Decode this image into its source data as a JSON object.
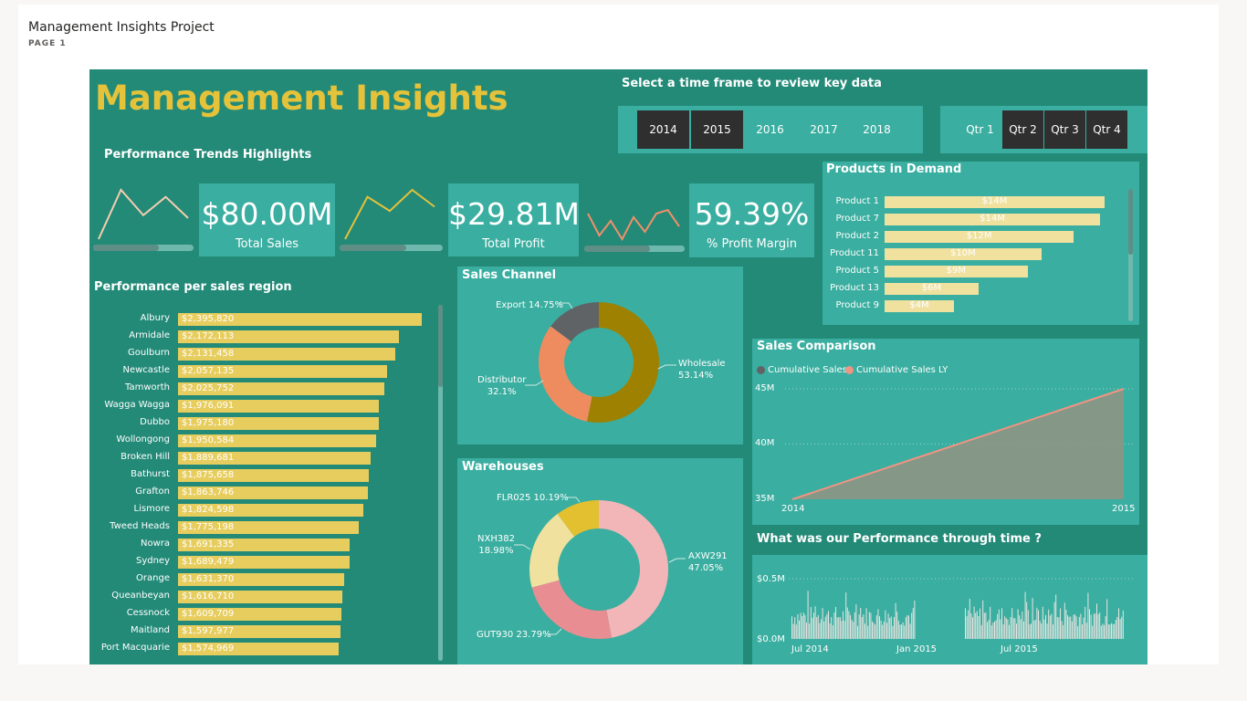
{
  "report": {
    "title": "Management Insights Project",
    "page_label": "PAGE 1"
  },
  "dashboard": {
    "title": "Management Insights",
    "time_caption": "Select a time frame to review key data",
    "years": [
      {
        "label": "2014",
        "selected": true
      },
      {
        "label": "2015",
        "selected": true
      },
      {
        "label": "2016",
        "selected": false
      },
      {
        "label": "2017",
        "selected": false
      },
      {
        "label": "2018",
        "selected": false
      }
    ],
    "quarters": [
      {
        "label": "Qtr 1",
        "selected": false
      },
      {
        "label": "Qtr 2",
        "selected": true
      },
      {
        "label": "Qtr 3",
        "selected": true
      },
      {
        "label": "Qtr 4",
        "selected": true
      }
    ],
    "trends_title": "Performance Trends Highlights",
    "kpis": [
      {
        "value": "$80.00M",
        "label": "Total Sales",
        "spark_color": "#f5cdb0",
        "spark": [
          5,
          40,
          22,
          35,
          20
        ],
        "progress": 0.65
      },
      {
        "value": "$29.81M",
        "label": "Total Profit",
        "spark_color": "#e4c23a",
        "spark": [
          5,
          35,
          25,
          40,
          28
        ],
        "progress": 0.65
      },
      {
        "value": "59.39%",
        "label": "% Profit Margin",
        "spark_color": "#f0906a",
        "spark": [
          22,
          10,
          18,
          8,
          20,
          12,
          22,
          24,
          15
        ],
        "progress": 0.65
      }
    ]
  },
  "regions": {
    "title": "Performance per sales region",
    "rows": [
      {
        "name": "Albury",
        "label": "$2,395,820",
        "value": 2395820
      },
      {
        "name": "Armidale",
        "label": "$2,172,113",
        "value": 2172113
      },
      {
        "name": "Goulburn",
        "label": "$2,131,458",
        "value": 2131458
      },
      {
        "name": "Newcastle",
        "label": "$2,057,135",
        "value": 2057135
      },
      {
        "name": "Tamworth",
        "label": "$2,025,752",
        "value": 2025752
      },
      {
        "name": "Wagga Wagga",
        "label": "$1,976,091",
        "value": 1976091
      },
      {
        "name": "Dubbo",
        "label": "$1,975,180",
        "value": 1975180
      },
      {
        "name": "Wollongong",
        "label": "$1,950,584",
        "value": 1950584
      },
      {
        "name": "Broken Hill",
        "label": "$1,889,681",
        "value": 1889681
      },
      {
        "name": "Bathurst",
        "label": "$1,875,658",
        "value": 1875658
      },
      {
        "name": "Grafton",
        "label": "$1,863,746",
        "value": 1863746
      },
      {
        "name": "Lismore",
        "label": "$1,824,598",
        "value": 1824598
      },
      {
        "name": "Tweed Heads",
        "label": "$1,775,198",
        "value": 1775198
      },
      {
        "name": "Nowra",
        "label": "$1,691,335",
        "value": 1691335
      },
      {
        "name": "Sydney",
        "label": "$1,689,479",
        "value": 1689479
      },
      {
        "name": "Orange",
        "label": "$1,631,370",
        "value": 1631370
      },
      {
        "name": "Queanbeyan",
        "label": "$1,616,710",
        "value": 1616710
      },
      {
        "name": "Cessnock",
        "label": "$1,609,709",
        "value": 1609709
      },
      {
        "name": "Maitland",
        "label": "$1,597,977",
        "value": 1597977
      },
      {
        "name": "Port Macquarie",
        "label": "$1,574,969",
        "value": 1574969
      }
    ]
  },
  "sales_channel": {
    "title": "Sales Channel",
    "slices": [
      {
        "name": "Wholesale",
        "label": "Wholesale",
        "pct_label": "53.14%",
        "value": 53.14,
        "color": "#9e8100"
      },
      {
        "name": "Distributor",
        "label": "Distributor",
        "pct_label": "32.1%",
        "value": 32.1,
        "color": "#ef8c5f"
      },
      {
        "name": "Export",
        "label": "Export 14.75%",
        "pct_label": "",
        "value": 14.75,
        "color": "#5f6366"
      }
    ]
  },
  "warehouses": {
    "title": "Warehouses",
    "slices": [
      {
        "name": "AXW291",
        "label": "AXW291",
        "pct_label": "47.05%",
        "value": 47.05,
        "color": "#f2b6b8"
      },
      {
        "name": "GUT930",
        "label": "GUT930 23.79%",
        "pct_label": "",
        "value": 23.79,
        "color": "#e88d92"
      },
      {
        "name": "NXH382",
        "label": "NXH382",
        "pct_label": "18.98%",
        "value": 18.98,
        "color": "#f0e19f"
      },
      {
        "name": "FLR025",
        "label": "FLR025 10.19%",
        "pct_label": "",
        "value": 10.19,
        "color": "#e2c02f"
      }
    ]
  },
  "products": {
    "title": "Products in Demand",
    "rows": [
      {
        "name": "Product 1",
        "label": "$14M",
        "value": 14.3
      },
      {
        "name": "Product 7",
        "label": "$14M",
        "value": 14.0
      },
      {
        "name": "Product 2",
        "label": "$12M",
        "value": 12.3
      },
      {
        "name": "Product 11",
        "label": "$10M",
        "value": 10.2
      },
      {
        "name": "Product 5",
        "label": "$9M",
        "value": 9.3
      },
      {
        "name": "Product 13",
        "label": "$6M",
        "value": 6.1
      },
      {
        "name": "Product 9",
        "label": "$4M",
        "value": 4.5
      }
    ]
  },
  "sales_comparison": {
    "title": "Sales Comparison",
    "legend": [
      {
        "label": "Cumulative Sales",
        "color": "#5f6366"
      },
      {
        "label": "Cumulative Sales LY",
        "color": "#f09483"
      }
    ],
    "y_ticks": [
      "45M",
      "40M",
      "35M"
    ],
    "x_ticks": [
      "2014",
      "2015"
    ],
    "chart_data": {
      "type": "area",
      "x": [
        "2014",
        "2015"
      ],
      "series": [
        {
          "name": "Cumulative Sales",
          "values": [
            35,
            45
          ]
        },
        {
          "name": "Cumulative Sales LY",
          "values": [
            35,
            45
          ]
        }
      ],
      "ylim": [
        35,
        45
      ]
    }
  },
  "performance_time": {
    "title": "What was our Performance through time ?",
    "y_ticks": [
      "$0.5M",
      "$0.0M"
    ],
    "x_ticks": [
      "Jul 2014",
      "Jan 2015",
      "Jul 2015"
    ],
    "bar_color": "#e8e4e0"
  }
}
